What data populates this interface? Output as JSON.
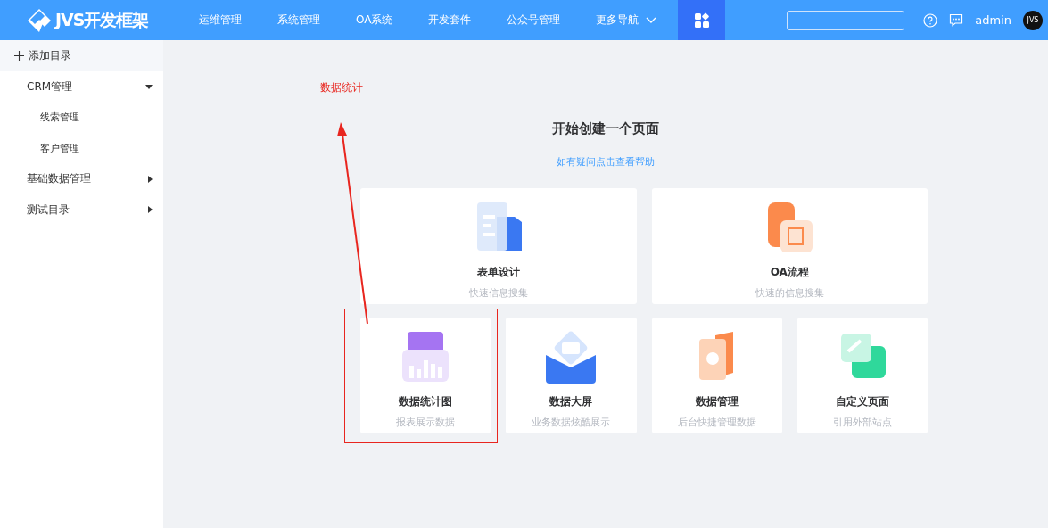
{
  "header": {
    "logo_text": "JVS开发框架",
    "nav": [
      {
        "label": "运维管理",
        "selected": false
      },
      {
        "label": "系统管理",
        "selected": false
      },
      {
        "label": "OA系统",
        "selected": false
      },
      {
        "label": "开发套件",
        "selected": false
      },
      {
        "label": "公众号管理",
        "selected": false
      },
      {
        "label": "更多导航",
        "selected": false,
        "kind": "dropdown"
      }
    ],
    "apps_button": {
      "selected": true
    },
    "user": "admin",
    "avatar_text": "JVS"
  },
  "sidebar": {
    "add_label": "添加目录",
    "items": [
      {
        "label": "CRM管理",
        "expanded": true,
        "children": [
          {
            "label": "线索管理"
          },
          {
            "label": "客户管理"
          }
        ]
      },
      {
        "label": "基础数据管理",
        "expanded": false
      },
      {
        "label": "测试目录",
        "expanded": false
      }
    ]
  },
  "annotation": {
    "label": "数据统计"
  },
  "main": {
    "title": "开始创建一个页面",
    "help_link": "如有疑问点击查看帮助",
    "cards": [
      {
        "title": "表单设计",
        "subtitle": "快速信息搜集",
        "kind": "wide",
        "highlighted": false
      },
      {
        "title": "OA流程",
        "subtitle": "快速的信息搜集",
        "kind": "wide",
        "highlighted": false
      },
      {
        "title": "数据统计图",
        "subtitle": "报表展示数据",
        "kind": "small",
        "highlighted": true
      },
      {
        "title": "数据大屏",
        "subtitle": "业务数据炫酷展示",
        "kind": "small",
        "highlighted": false
      },
      {
        "title": "数据管理",
        "subtitle": "后台快捷管理数据",
        "kind": "small",
        "highlighted": false
      },
      {
        "title": "自定义页面",
        "subtitle": "引用外部站点",
        "kind": "small",
        "highlighted": false
      }
    ]
  }
}
